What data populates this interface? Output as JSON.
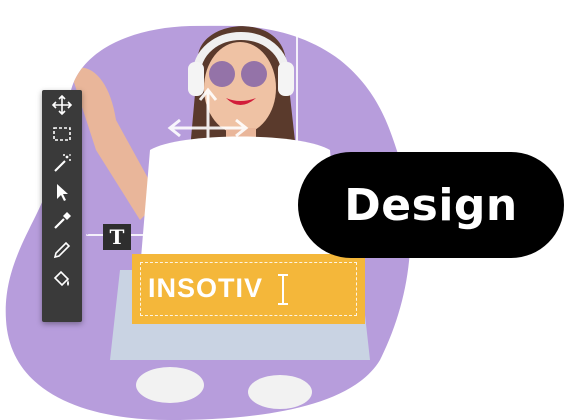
{
  "colors": {
    "blob": "#b79ddc",
    "blob_dark": "#9a7fca",
    "toolbar_bg": "#3a3a3a",
    "text_box_bg": "#f4b73a",
    "pill_bg": "#000000",
    "skin": "#e9b69a",
    "shirt": "#ffffff",
    "jeans": "#c9d3e3"
  },
  "toolbar": {
    "tools": [
      {
        "name": "move-tool",
        "icon": "move-arrows-icon"
      },
      {
        "name": "marquee-tool",
        "icon": "rect-select-icon"
      },
      {
        "name": "magic-wand-tool",
        "icon": "magic-wand-icon"
      },
      {
        "name": "pointer-tool",
        "icon": "pointer-arrow-icon"
      },
      {
        "name": "eyedropper-tool",
        "icon": "eyedropper-icon"
      },
      {
        "name": "pencil-tool",
        "icon": "pencil-icon"
      },
      {
        "name": "paint-bucket-tool",
        "icon": "paint-bucket-icon"
      }
    ]
  },
  "text_tool": {
    "glyph": "T",
    "icon": "text-tool-icon"
  },
  "text_box": {
    "value": "INSOTIV"
  },
  "pill": {
    "label": "Design"
  }
}
